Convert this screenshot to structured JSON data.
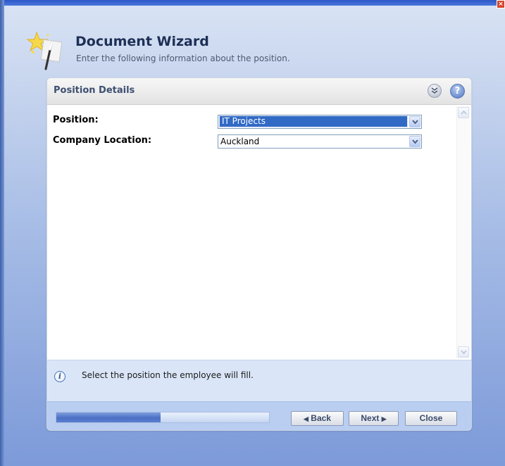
{
  "header": {
    "title": "Document Wizard",
    "subtitle": "Enter the following information about the position."
  },
  "panel": {
    "title": "Position Details"
  },
  "fields": [
    {
      "label": "Position:",
      "value": "IT Projects"
    },
    {
      "label": "Company Location:",
      "value": "Auckland"
    }
  ],
  "info": {
    "text": "Select the position the employee will fill."
  },
  "footer": {
    "progress_fraction": 0.49,
    "back_label": "Back",
    "next_label": "Next",
    "close_label": "Close"
  },
  "icons": {
    "window_close": "close-icon",
    "collapse": "double-chevron-down-icon",
    "help": "help-icon",
    "info": "info-icon",
    "wizard": "magic-wand-icon"
  },
  "colors": {
    "selection": "#316ac5",
    "progress": "#4b70c3",
    "title_text": "#1d2f55"
  }
}
